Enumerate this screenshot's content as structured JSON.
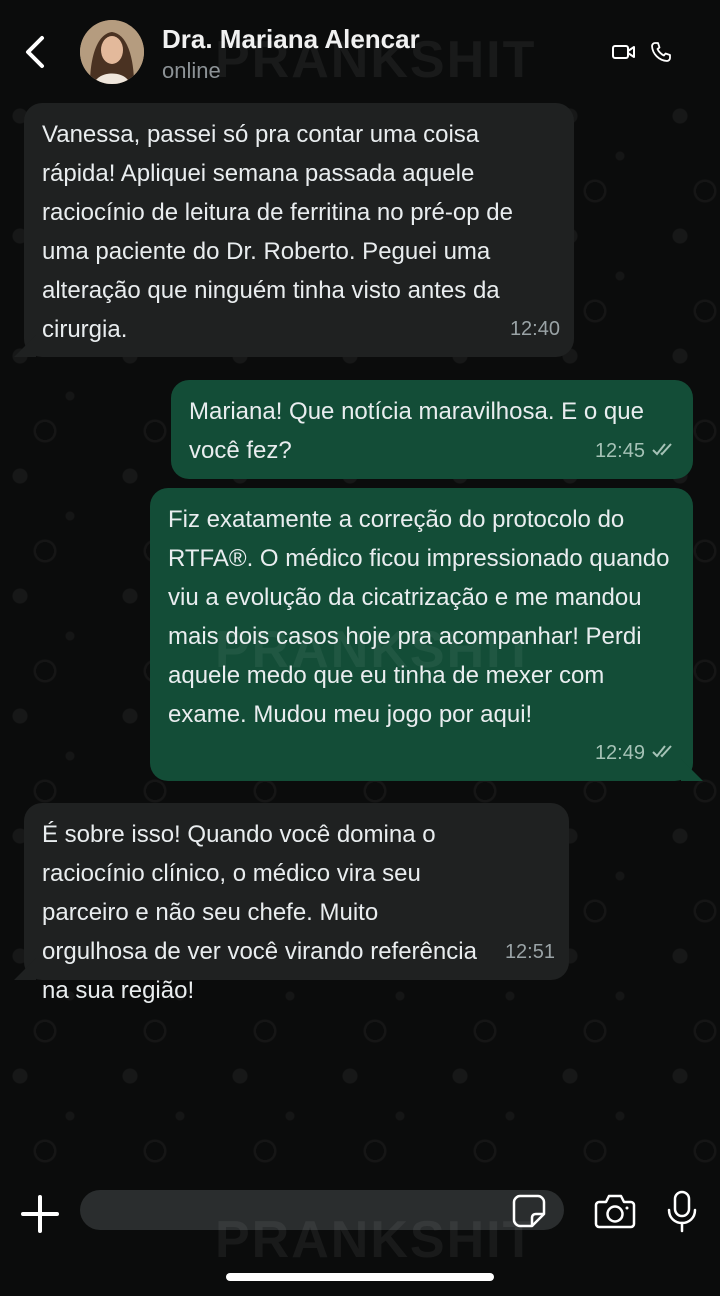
{
  "header": {
    "contact_name": "Dra. Mariana Alencar",
    "status": "online",
    "icons": [
      "back-icon",
      "avatar",
      "video-call-icon",
      "phone-icon"
    ]
  },
  "watermark": "PRANKSHIT",
  "messages": [
    {
      "direction": "incoming",
      "text": "Vanessa, passei só pra contar uma coisa rápida! Apliquei semana passada aquele raciocínio de leitura de ferritina no pré-op de uma paciente do Dr. Roberto. Peguei uma alteração que ninguém tinha visto antes da cirurgia.",
      "time": "12:40"
    },
    {
      "direction": "outgoing",
      "text": "Mariana! Que notícia maravilhosa. E o que você fez?",
      "time": "12:45",
      "status": "read"
    },
    {
      "direction": "outgoing",
      "text": "Fiz exatamente a correção do protocolo do RTFA®. O médico ficou impressionado quando viu a evolução da cicatrização e me mandou mais dois casos hoje pra acompanhar! Perdi aquele medo que eu tinha de mexer com exame. Mudou meu jogo por aqui!",
      "time": "12:49",
      "status": "read"
    },
    {
      "direction": "incoming",
      "text": "É sobre isso! Quando você domina o raciocínio clínico, o médico vira seu parceiro e não seu chefe. Muito orgulhosa de ver você virando referência na sua região!",
      "time": "12:51"
    }
  ],
  "composer": {
    "placeholder": "",
    "icons": [
      "plus-icon",
      "sticker-icon",
      "camera-icon",
      "mic-icon"
    ]
  },
  "colors": {
    "background": "#0b0c0c",
    "incoming_bubble": "#1f2121",
    "outgoing_bubble": "#134d37",
    "read_ticks": "#a5c2b6"
  }
}
